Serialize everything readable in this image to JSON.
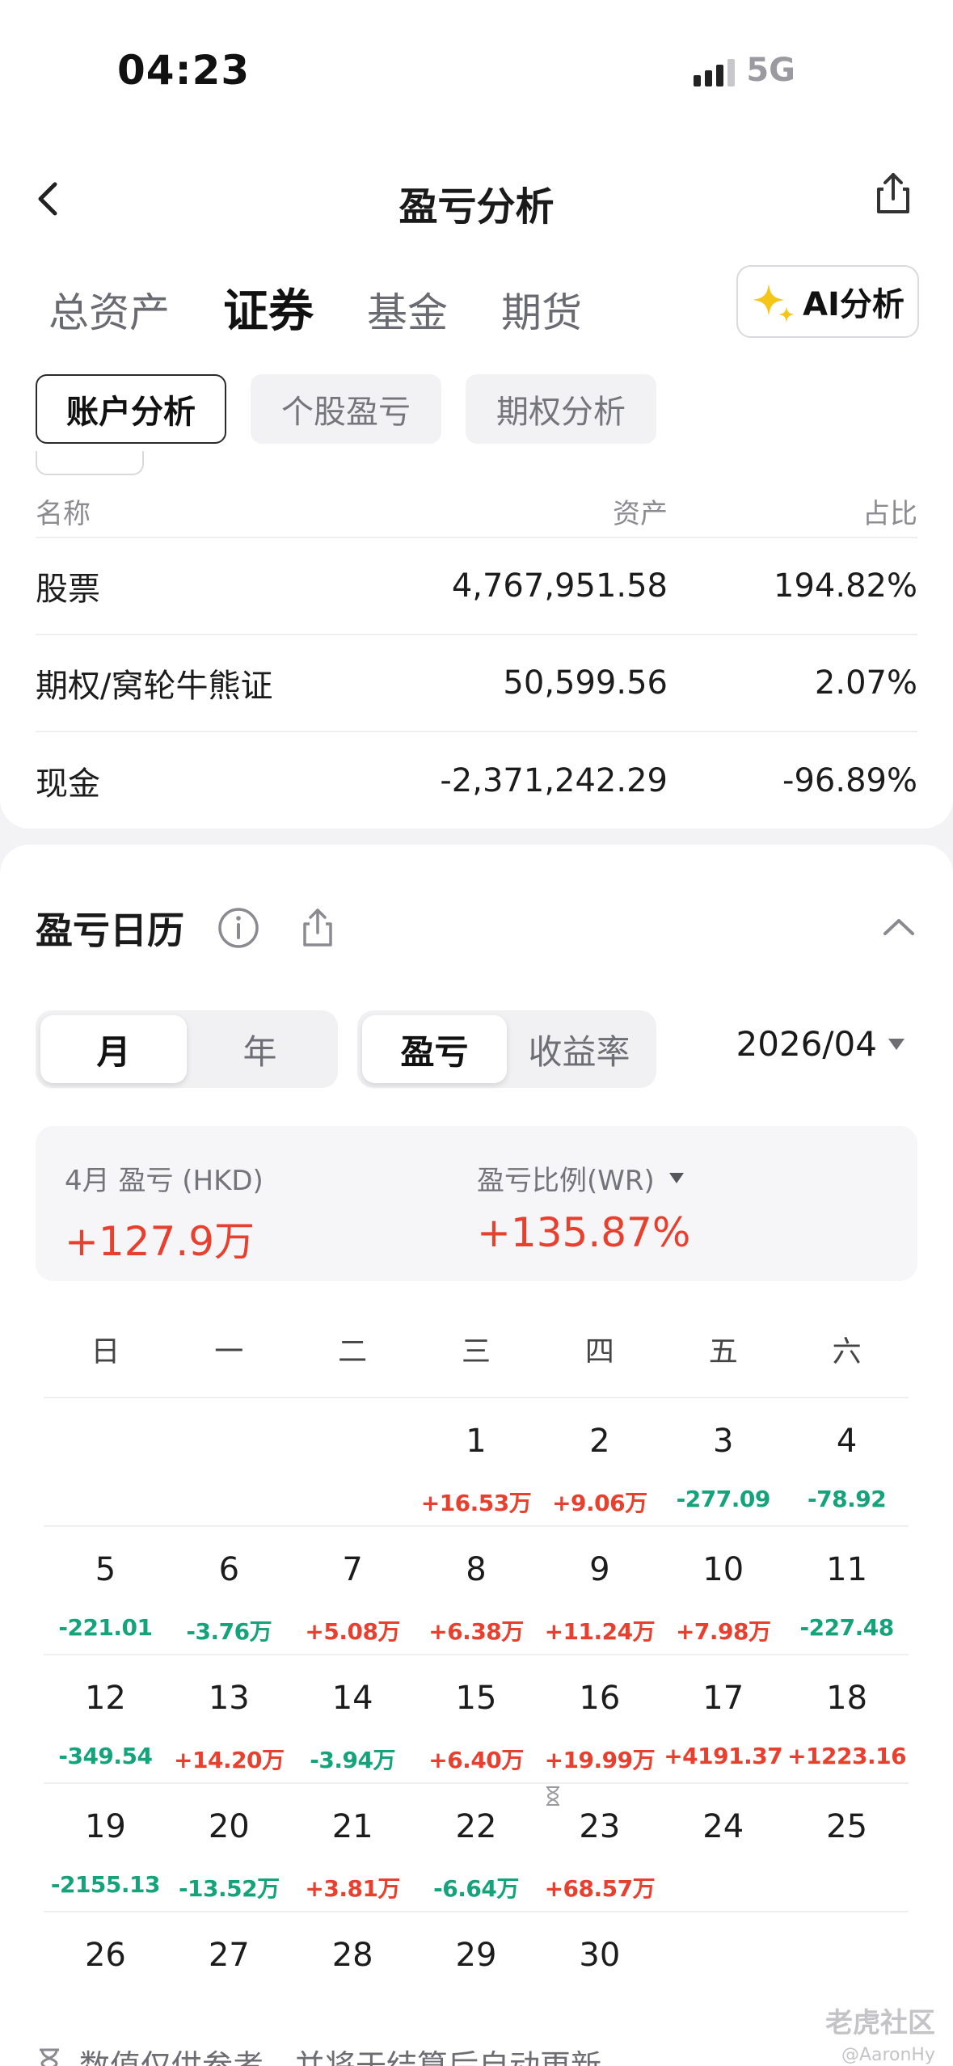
{
  "status_bar": {
    "time": "04:23",
    "network": "5G"
  },
  "nav": {
    "title": "盈亏分析"
  },
  "main_tabs": [
    "总资产",
    "证券",
    "基金",
    "期货"
  ],
  "ai_button": {
    "label": "AI分析"
  },
  "sub_tabs": [
    "账户分析",
    "个股盈亏",
    "期权分析"
  ],
  "asset_table": {
    "headers": {
      "name": "名称",
      "asset": "资产",
      "pct": "占比"
    },
    "rows": [
      {
        "name": "股票",
        "asset": "4,767,951.58",
        "pct": "194.82%"
      },
      {
        "name": "期权/窝轮牛熊证",
        "asset": "50,599.56",
        "pct": "2.07%"
      },
      {
        "name": "现金",
        "asset": "-2,371,242.29",
        "pct": "-96.89%"
      }
    ]
  },
  "calendar": {
    "title": "盈亏日历",
    "period_toggle": [
      "月",
      "年"
    ],
    "metric_toggle": [
      "盈亏",
      "收益率"
    ],
    "month": "2026/04",
    "summary": {
      "pl_label": "4月 盈亏 (HKD)",
      "pl_value": "+127.9万",
      "ratio_label": "盈亏比例(WR)",
      "ratio_value": "+135.87%"
    },
    "weekdays": [
      "日",
      "一",
      "二",
      "三",
      "四",
      "五",
      "六"
    ],
    "weeks": [
      [
        {
          "d": "",
          "v": ""
        },
        {
          "d": "",
          "v": ""
        },
        {
          "d": "",
          "v": ""
        },
        {
          "d": "1",
          "v": "+16.53万"
        },
        {
          "d": "2",
          "v": "+9.06万"
        },
        {
          "d": "3",
          "v": "-277.09"
        },
        {
          "d": "4",
          "v": "-78.92"
        }
      ],
      [
        {
          "d": "5",
          "v": "-221.01"
        },
        {
          "d": "6",
          "v": "-3.76万"
        },
        {
          "d": "7",
          "v": "+5.08万"
        },
        {
          "d": "8",
          "v": "+6.38万"
        },
        {
          "d": "9",
          "v": "+11.24万"
        },
        {
          "d": "10",
          "v": "+7.98万"
        },
        {
          "d": "11",
          "v": "-227.48"
        }
      ],
      [
        {
          "d": "12",
          "v": "-349.54"
        },
        {
          "d": "13",
          "v": "+14.20万"
        },
        {
          "d": "14",
          "v": "-3.94万"
        },
        {
          "d": "15",
          "v": "+6.40万"
        },
        {
          "d": "16",
          "v": "+19.99万"
        },
        {
          "d": "17",
          "v": "+4191.37"
        },
        {
          "d": "18",
          "v": "+1223.16"
        }
      ],
      [
        {
          "d": "19",
          "v": "-2155.13"
        },
        {
          "d": "20",
          "v": "-13.52万"
        },
        {
          "d": "21",
          "v": "+3.81万"
        },
        {
          "d": "22",
          "v": "-6.64万"
        },
        {
          "d": "23",
          "v": "+68.57万"
        },
        {
          "d": "24",
          "v": ""
        },
        {
          "d": "25",
          "v": ""
        }
      ],
      [
        {
          "d": "26",
          "v": ""
        },
        {
          "d": "27",
          "v": ""
        },
        {
          "d": "28",
          "v": ""
        },
        {
          "d": "29",
          "v": ""
        },
        {
          "d": "30",
          "v": ""
        },
        {
          "d": "",
          "v": ""
        },
        {
          "d": "",
          "v": ""
        }
      ]
    ],
    "footer_note": "数值仅供参考，并将于结算后自动更新"
  },
  "colors": {
    "profit": "#e8402f",
    "loss": "#14a37a"
  },
  "watermark": {
    "brand": "老虎社区",
    "user": "@AaronHy"
  }
}
